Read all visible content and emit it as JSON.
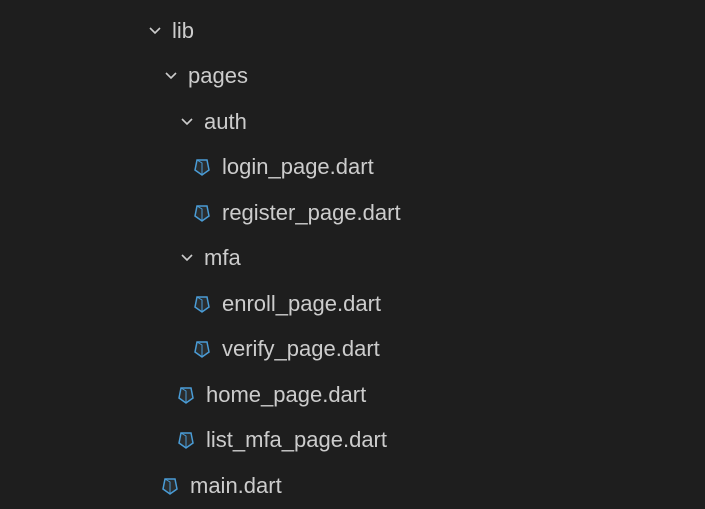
{
  "tree": {
    "lib": {
      "label": "lib",
      "expanded": true
    },
    "pages": {
      "label": "pages",
      "expanded": true
    },
    "auth": {
      "label": "auth",
      "expanded": true
    },
    "login_page": {
      "label": "login_page.dart"
    },
    "register_page": {
      "label": "register_page.dart"
    },
    "mfa": {
      "label": "mfa",
      "expanded": true
    },
    "enroll_page": {
      "label": "enroll_page.dart"
    },
    "verify_page": {
      "label": "verify_page.dart"
    },
    "home_page": {
      "label": "home_page.dart"
    },
    "list_mfa_page": {
      "label": "list_mfa_page.dart"
    },
    "main": {
      "label": "main.dart"
    }
  }
}
